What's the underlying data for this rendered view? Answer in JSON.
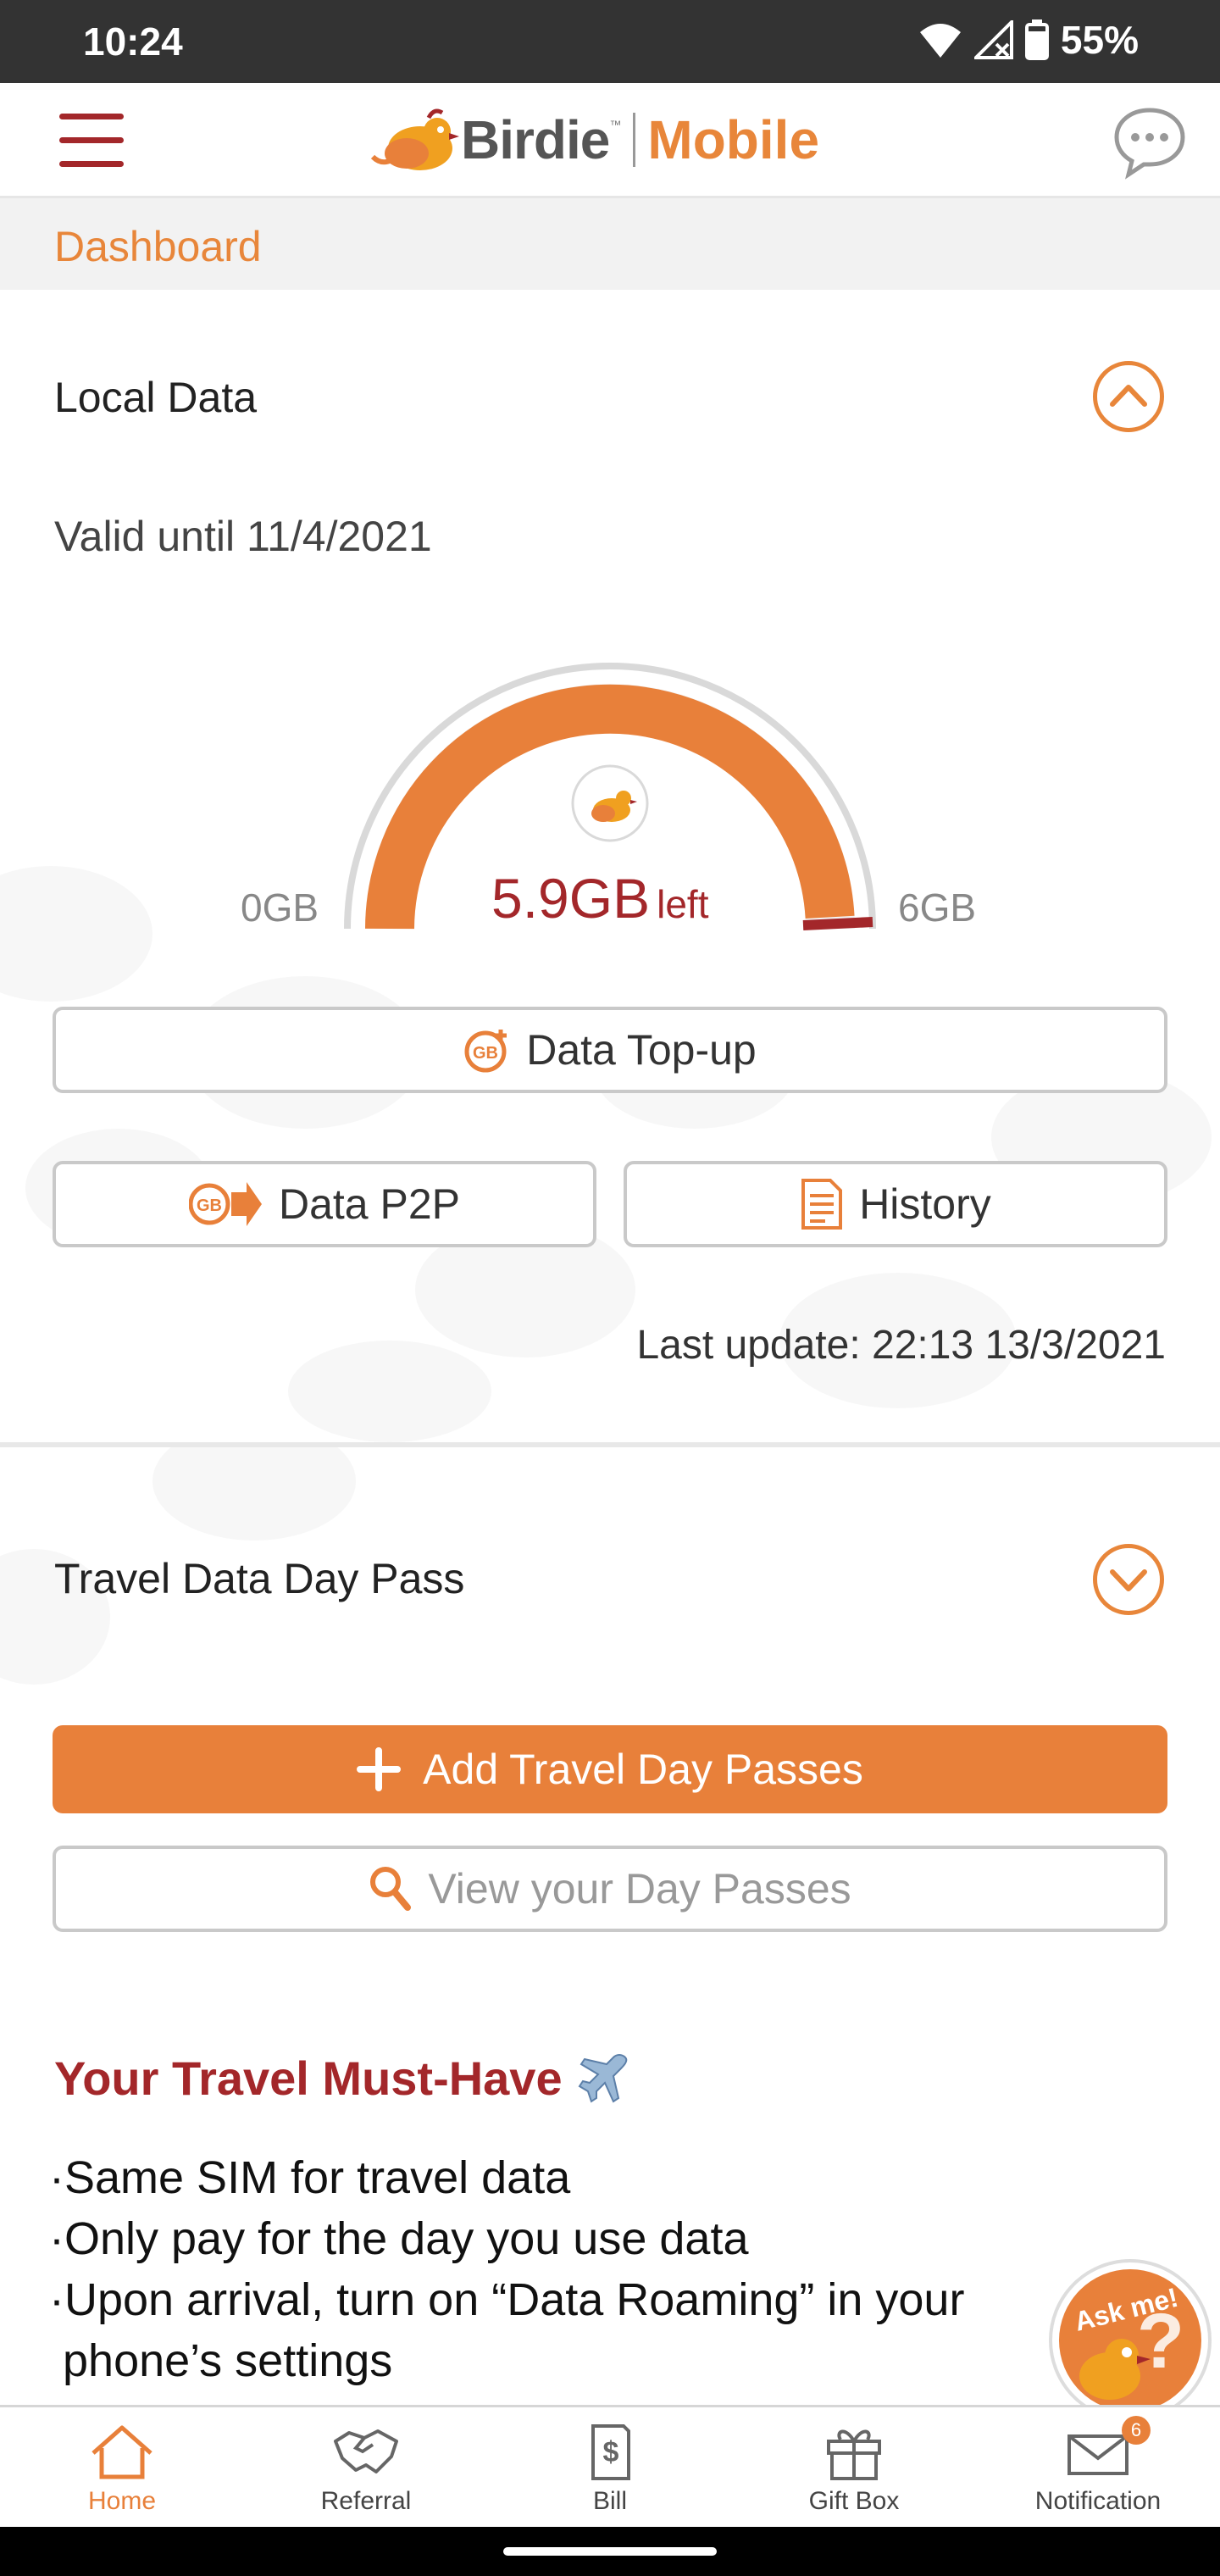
{
  "status_bar": {
    "time": "10:24",
    "battery": "55%"
  },
  "header": {
    "brand_name": "Birdie",
    "brand_tm": "™",
    "brand_suffix": "Mobile"
  },
  "page": {
    "breadcrumb": "Dashboard"
  },
  "local_data": {
    "title": "Local Data",
    "valid_until": "Valid until 11/4/2021",
    "gauge": {
      "min_label": "0GB",
      "max_label": "6GB",
      "value_text": "5.9GB",
      "value_suffix": "left",
      "remaining_gb": 5.9,
      "total_gb": 6
    },
    "topup_label": "Data Top-up",
    "p2p_label": "Data P2P",
    "history_label": "History",
    "last_update": "Last update: 22:13 13/3/2021"
  },
  "travel": {
    "title": "Travel Data Day Pass",
    "add_label": "Add Travel Day Passes",
    "view_label": "View your Day Passes",
    "promo_title": "Your Travel Must-Have",
    "bullets": [
      "·Same SIM for travel data",
      "·Only pay for the day you use data",
      "·Upon arrival, turn on “Data Roaming” in your",
      "phone’s settings"
    ]
  },
  "askme": {
    "label": "Ask me!"
  },
  "bottom_nav": {
    "items": [
      {
        "label": "Home"
      },
      {
        "label": "Referral"
      },
      {
        "label": "Bill"
      },
      {
        "label": "Gift Box"
      },
      {
        "label": "Notification"
      }
    ],
    "notification_count": "6"
  },
  "colors": {
    "brand_orange": "#e8803a",
    "brand_red": "#a3272a"
  }
}
